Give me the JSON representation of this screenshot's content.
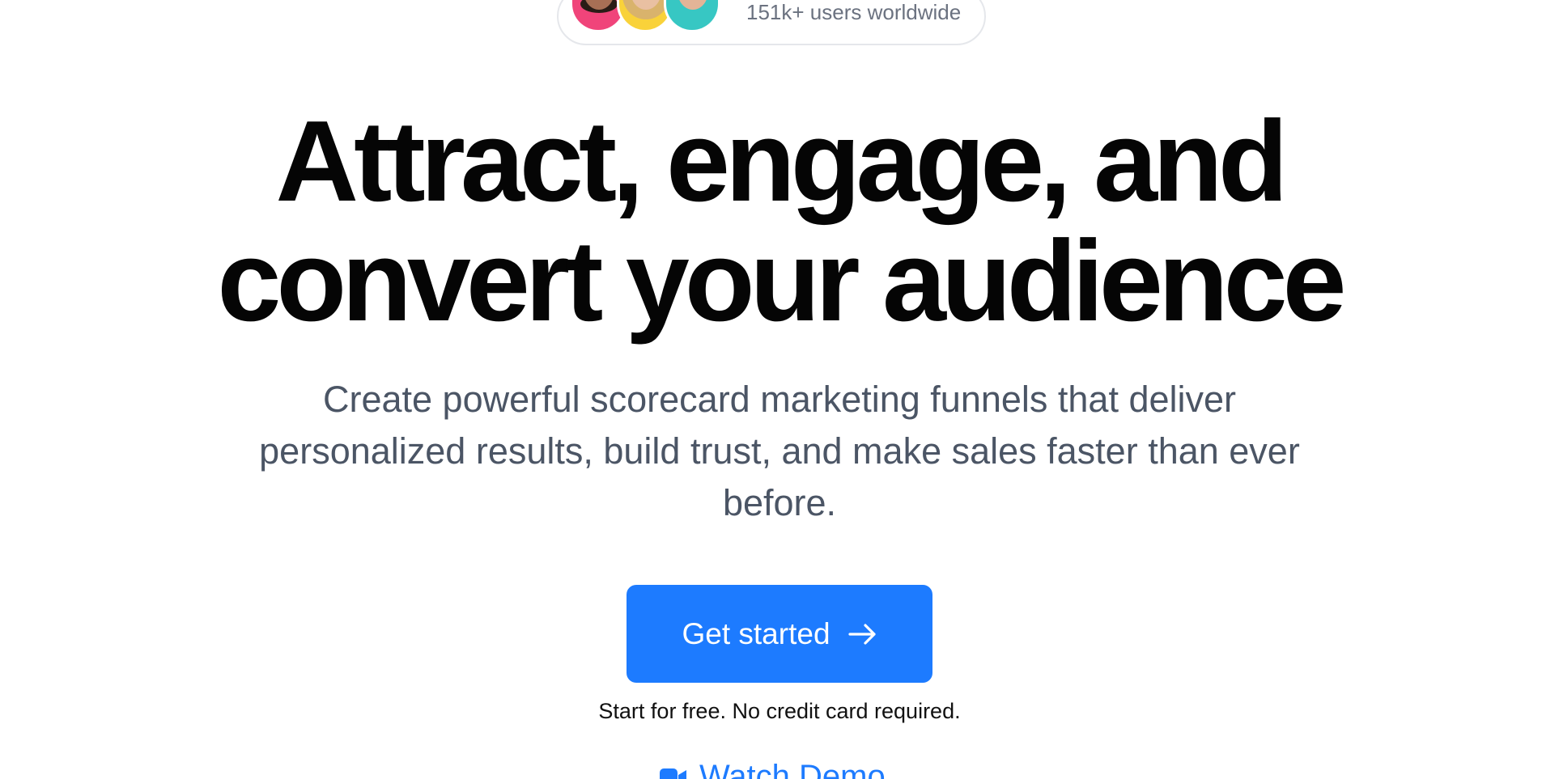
{
  "social_proof": {
    "text": "151k+ users worldwide"
  },
  "hero": {
    "headline_line1": "Attract, engage, and",
    "headline_line2": "convert your audience",
    "subheadline": "Create powerful scorecard marketing funnels that deliver personalized results, build trust, and make sales faster than ever before."
  },
  "cta": {
    "button_label": "Get started",
    "note": "Start for free. No credit card required.",
    "secondary_label": "Watch Demo"
  },
  "colors": {
    "primary": "#1d7bff",
    "headline": "#050505",
    "body": "#4b5565"
  }
}
